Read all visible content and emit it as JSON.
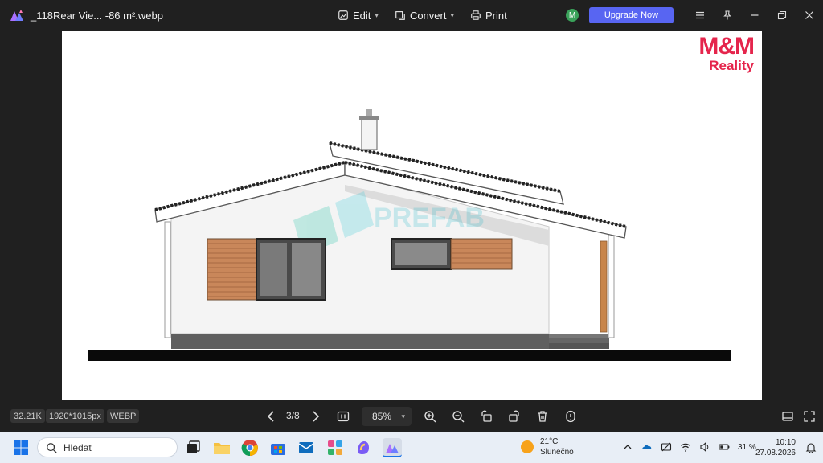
{
  "app": {
    "file_title": "_118Rear Vie... -86 m².webp",
    "menu_edit": "Edit",
    "menu_convert": "Convert",
    "menu_print": "Print",
    "avatar_initial": "M",
    "upgrade_label": "Upgrade Now",
    "accent_color": "#5865f2"
  },
  "image": {
    "brand_line1": "M&M",
    "brand_line2": "Reality",
    "watermark": "PREFAB",
    "brand_color": "#e5254c"
  },
  "status": {
    "file_size": "32.21K",
    "dimensions": "1920*1015px",
    "format": "WEBP",
    "page_indicator": "3/8",
    "zoom": "85%"
  },
  "taskbar": {
    "search_placeholder": "Hledat",
    "temperature": "21°C",
    "weather_desc": "Slunečno",
    "battery": "31 %",
    "time": "10:10",
    "date": "27.08.2026"
  }
}
